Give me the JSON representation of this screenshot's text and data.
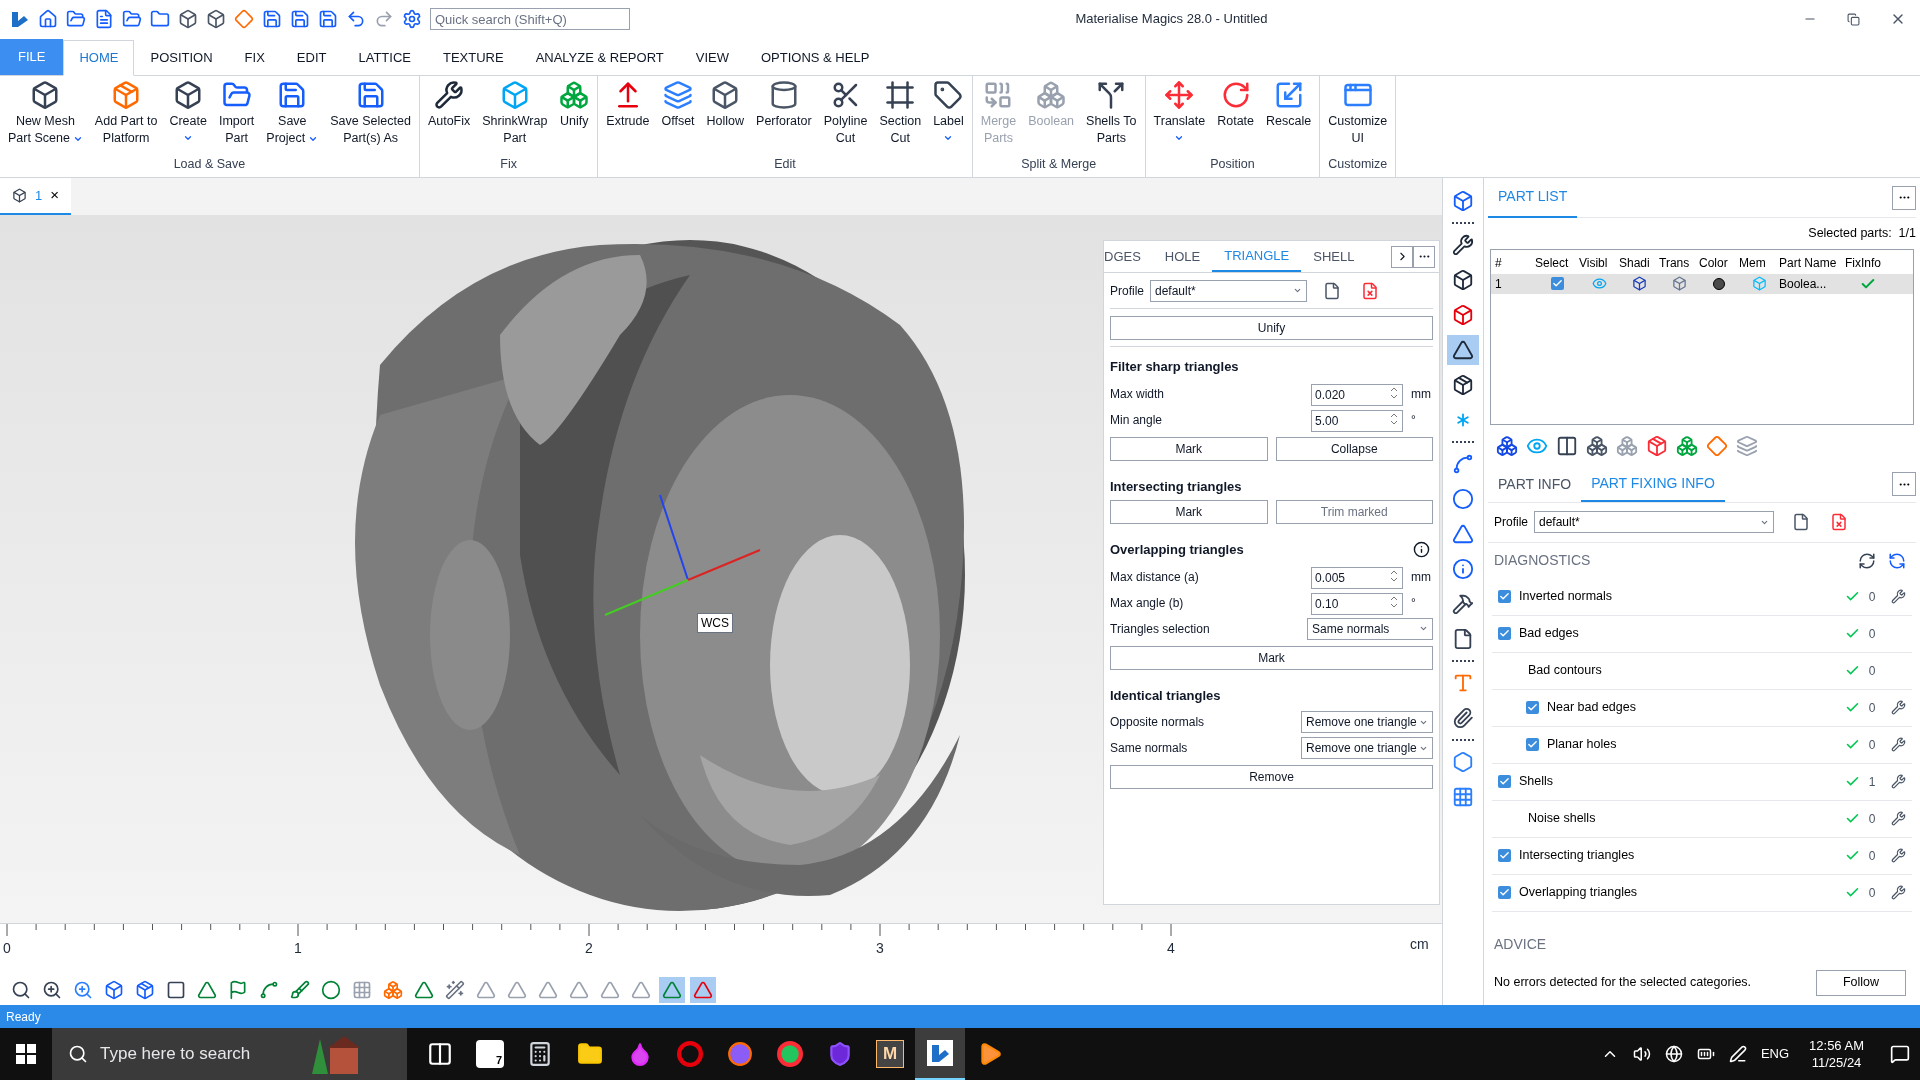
{
  "title_bar": {
    "search": {
      "placeholder": "Quick search (Shift+Q)"
    },
    "title": "Materialise Magics 28.0 - Untitled"
  },
  "menu_tabs": [
    {
      "label": "FILE",
      "kind": "file",
      "selected": false
    },
    {
      "label": "HOME",
      "kind": "tab",
      "selected": true
    },
    {
      "label": "POSITION",
      "kind": "tab",
      "selected": false
    },
    {
      "label": "FIX",
      "kind": "tab",
      "selected": false
    },
    {
      "label": "EDIT",
      "kind": "tab",
      "selected": false
    },
    {
      "label": "LATTICE",
      "kind": "tab",
      "selected": false
    },
    {
      "label": "TEXTURE",
      "kind": "tab",
      "selected": false
    },
    {
      "label": "ANALYZE & REPORT",
      "kind": "tab",
      "selected": false
    },
    {
      "label": "VIEW",
      "kind": "tab",
      "selected": false
    },
    {
      "label": "OPTIONS & HELP",
      "kind": "tab",
      "selected": false
    }
  ],
  "ribbon_groups": [
    {
      "label": "Load & Save",
      "buttons": [
        {
          "lines": [
            "New Mesh",
            "Part Scene"
          ],
          "kind": "mesh",
          "dropdown": true,
          "disabled": false
        },
        {
          "lines": [
            "Add Part to",
            "Platform"
          ],
          "kind": "platform",
          "dropdown": false,
          "disabled": false
        },
        {
          "lines": [
            "Create"
          ],
          "kind": "create",
          "dropdown": true,
          "disabled": false
        },
        {
          "lines": [
            "Import",
            "Part"
          ],
          "kind": "import",
          "dropdown": false,
          "disabled": false
        },
        {
          "lines": [
            "Save",
            "Project"
          ],
          "kind": "save",
          "dropdown": true,
          "disabled": false
        },
        {
          "lines": [
            "Save Selected",
            "Part(s) As"
          ],
          "kind": "save-parts",
          "dropdown": false,
          "disabled": false
        }
      ]
    },
    {
      "label": "Fix",
      "buttons": [
        {
          "lines": [
            "AutoFix"
          ],
          "kind": "autofix",
          "dropdown": false,
          "disabled": false
        },
        {
          "lines": [
            "ShrinkWrap",
            "Part"
          ],
          "kind": "shrinkwrap",
          "dropdown": false,
          "disabled": false
        },
        {
          "lines": [
            "Unify"
          ],
          "kind": "unify",
          "dropdown": false,
          "disabled": false
        }
      ]
    },
    {
      "label": "Edit",
      "buttons": [
        {
          "lines": [
            "Extrude"
          ],
          "kind": "extrude",
          "dropdown": false,
          "disabled": false
        },
        {
          "lines": [
            "Offset"
          ],
          "kind": "offset",
          "dropdown": false,
          "disabled": false
        },
        {
          "lines": [
            "Hollow"
          ],
          "kind": "hollow",
          "dropdown": false,
          "disabled": false
        },
        {
          "lines": [
            "Perforator"
          ],
          "kind": "perforator",
          "dropdown": false,
          "disabled": false
        },
        {
          "lines": [
            "Polyline",
            "Cut"
          ],
          "kind": "polyline",
          "dropdown": false,
          "disabled": false
        },
        {
          "lines": [
            "Section",
            "Cut"
          ],
          "kind": "section",
          "dropdown": false,
          "disabled": false
        },
        {
          "lines": [
            "Label"
          ],
          "kind": "label",
          "dropdown": true,
          "disabled": false
        }
      ]
    },
    {
      "label": "Split & Merge",
      "buttons": [
        {
          "lines": [
            "Merge",
            "Parts"
          ],
          "kind": "merge",
          "dropdown": false,
          "disabled": true
        },
        {
          "lines": [
            "Boolean"
          ],
          "kind": "boolean",
          "dropdown": false,
          "disabled": true
        },
        {
          "lines": [
            "Shells To",
            "Parts"
          ],
          "kind": "shells",
          "dropdown": false,
          "disabled": false
        }
      ]
    },
    {
      "label": "Position",
      "buttons": [
        {
          "lines": [
            "Translate"
          ],
          "kind": "translate",
          "dropdown": true,
          "disabled": false
        },
        {
          "lines": [
            "Rotate"
          ],
          "kind": "rotate",
          "dropdown": false,
          "disabled": false
        },
        {
          "lines": [
            "Rescale"
          ],
          "kind": "rescale",
          "dropdown": false,
          "disabled": false
        }
      ]
    },
    {
      "label": "Customize",
      "buttons": [
        {
          "lines": [
            "Customize",
            "UI"
          ],
          "kind": "customize",
          "dropdown": false,
          "disabled": false
        }
      ]
    }
  ],
  "document_tab": {
    "label": "1",
    "close": "×"
  },
  "viewport": {
    "axis_label": "WCS",
    "ruler": {
      "marks": [
        "0",
        "1",
        "2",
        "3",
        "4"
      ],
      "unit": "cm"
    }
  },
  "fix_panel": {
    "tabs": [
      {
        "label": "DGES",
        "selected": false
      },
      {
        "label": "HOLE",
        "selected": false
      },
      {
        "label": "TRIANGLE",
        "selected": true
      },
      {
        "label": "SHELL",
        "selected": false
      }
    ],
    "profile": {
      "label": "Profile",
      "value": "default*"
    },
    "unify_button": "Unify",
    "sections": [
      {
        "title": "Filter sharp triangles",
        "info": false,
        "fields": [
          {
            "label": "Max width",
            "value": "0.020",
            "unit": "mm"
          },
          {
            "label": "Min angle",
            "value": "5.00",
            "unit": "°"
          }
        ],
        "buttons": [
          {
            "label": "Mark",
            "disabled": false
          },
          {
            "label": "Collapse",
            "disabled": false
          }
        ]
      },
      {
        "title": "Intersecting triangles",
        "info": false,
        "buttons": [
          {
            "label": "Mark",
            "disabled": false
          },
          {
            "label": "Trim marked",
            "disabled": true
          }
        ]
      },
      {
        "title": "Overlapping triangles",
        "info": true,
        "fields": [
          {
            "label": "Max distance (a)",
            "value": "0.005",
            "unit": "mm"
          },
          {
            "label": "Max angle (b)",
            "value": "0.10",
            "unit": "°"
          }
        ],
        "selects": [
          {
            "label": "Triangles selection",
            "value": "Same normals"
          }
        ],
        "buttons": [
          {
            "label": "Mark",
            "disabled": false
          }
        ]
      },
      {
        "title": "Identical triangles",
        "info": false,
        "selects": [
          {
            "label": "Opposite normals",
            "value": "Remove one triangle"
          },
          {
            "label": "Same normals",
            "value": "Remove one triangle"
          }
        ],
        "buttons": [
          {
            "label": "Remove",
            "disabled": false
          }
        ]
      }
    ]
  },
  "side_tools": [
    {
      "kind": "part",
      "selected": false
    },
    {
      "kind": "separator"
    },
    {
      "kind": "wrench",
      "selected": false
    },
    {
      "kind": "box-tool",
      "selected": false
    },
    {
      "kind": "box-red",
      "selected": false
    },
    {
      "kind": "triangle",
      "selected": true
    },
    {
      "kind": "box-dark",
      "selected": false
    },
    {
      "kind": "star",
      "selected": false
    },
    {
      "kind": "separator"
    },
    {
      "kind": "points",
      "selected": false
    },
    {
      "kind": "circle",
      "selected": false
    },
    {
      "kind": "angle",
      "selected": false
    },
    {
      "kind": "distance",
      "selected": false
    },
    {
      "kind": "hammer",
      "selected": false
    },
    {
      "kind": "page",
      "selected": false
    },
    {
      "kind": "separator"
    },
    {
      "kind": "text",
      "selected": false
    },
    {
      "kind": "clip",
      "selected": false
    },
    {
      "kind": "separator"
    },
    {
      "kind": "mesh",
      "selected": false
    },
    {
      "kind": "grid",
      "selected": false
    }
  ],
  "view_tools": [
    {
      "kind": "zoom",
      "selected": false
    },
    {
      "kind": "zoom-fit",
      "selected": false
    },
    {
      "kind": "zoom-select",
      "selected": false
    },
    {
      "kind": "view-cube",
      "selected": false
    },
    {
      "kind": "box",
      "selected": false
    },
    {
      "kind": "shade",
      "selected": false
    },
    {
      "kind": "triangle",
      "selected": false
    },
    {
      "kind": "flag",
      "selected": false
    },
    {
      "kind": "spline",
      "selected": false
    },
    {
      "kind": "brush",
      "selected": false
    },
    {
      "kind": "sphere",
      "selected": false
    },
    {
      "kind": "mesh",
      "selected": false
    },
    {
      "kind": "parts",
      "selected": false
    },
    {
      "kind": "triangle",
      "selected": false
    },
    {
      "kind": "wand",
      "selected": false
    },
    {
      "kind": "triangle-light",
      "selected": false
    },
    {
      "kind": "triangle-light",
      "selected": false
    },
    {
      "kind": "triangle-light",
      "selected": false
    },
    {
      "kind": "triangle-light",
      "selected": false
    },
    {
      "kind": "triangle-light",
      "selected": false
    },
    {
      "kind": "triangle-light",
      "selected": false
    },
    {
      "kind": "triangle",
      "selected": true
    },
    {
      "kind": "triangle-red",
      "selected": true
    }
  ],
  "part_list": {
    "tab": {
      "label": "PART LIST",
      "selected": true
    },
    "summary": "Selected parts:  1/1",
    "columns": [
      "#",
      "Select",
      "Visibl",
      "Shadi",
      "Trans",
      "Color",
      "Mem",
      "Part Name",
      "FixInfo"
    ],
    "rows": [
      {
        "number": "1",
        "selected": true,
        "checked": true,
        "visible": true,
        "color": "#4a4a4a",
        "name": "Boolea...",
        "fixed": true
      }
    ]
  },
  "info_tabs": [
    {
      "label": "PART INFO",
      "selected": false
    },
    {
      "label": "PART FIXING INFO",
      "selected": true
    }
  ],
  "fixing": {
    "profile": {
      "label": "Profile",
      "value": "default*"
    },
    "diagnostics_title": "DIAGNOSTICS",
    "diagnostics": [
      {
        "label": "Inverted normals",
        "kind": "check",
        "checked": true,
        "ok": true,
        "count": "0",
        "fix_tool": true
      },
      {
        "label": "Bad edges",
        "kind": "check",
        "checked": true,
        "ok": true,
        "count": "0",
        "fix_tool": false,
        "children": [
          {
            "label": "Bad contours",
            "kind": "plain",
            "ok": true,
            "count": "0",
            "fix_tool": false,
            "children": [
              {
                "label": "Near bad edges",
                "kind": "check",
                "checked": true,
                "ok": true,
                "count": "0",
                "fix_tool": true
              },
              {
                "label": "Planar holes",
                "kind": "check",
                "checked": true,
                "ok": true,
                "count": "0",
                "fix_tool": true
              }
            ]
          }
        ]
      },
      {
        "label": "Shells",
        "kind": "check",
        "checked": true,
        "ok": true,
        "count": "1",
        "fix_tool": true,
        "children": [
          {
            "label": "Noise shells",
            "kind": "plain",
            "ok": true,
            "count": "0",
            "fix_tool": true
          }
        ]
      },
      {
        "label": "Intersecting triangles",
        "kind": "check",
        "checked": true,
        "ok": true,
        "count": "0",
        "fix_tool": true
      },
      {
        "label": "Overlapping triangles",
        "kind": "check",
        "checked": true,
        "ok": true,
        "count": "0",
        "fix_tool": true
      }
    ],
    "advice_title": "ADVICE",
    "advice": "No errors detected for the selected categories.",
    "follow_button": "Follow"
  },
  "status_bar": "Ready",
  "taskbar": {
    "search": {
      "placeholder": "Type here to search"
    },
    "apps": [
      {
        "kind": "task-view",
        "selected": false
      },
      {
        "kind": "rhino",
        "label": "7",
        "selected": false
      },
      {
        "kind": "calculator",
        "selected": false
      },
      {
        "kind": "explorer",
        "selected": false
      },
      {
        "kind": "drop",
        "selected": false
      },
      {
        "kind": "opera",
        "selected": false
      },
      {
        "kind": "firefox",
        "selected": false
      },
      {
        "kind": "chrome",
        "selected": false
      },
      {
        "kind": "shield",
        "selected": false
      },
      {
        "kind": "letter",
        "label": "M",
        "selected": false
      },
      {
        "kind": "magics",
        "selected": true
      },
      {
        "kind": "player",
        "selected": false
      }
    ],
    "language": "ENG",
    "time": "12:56 AM",
    "date": "11/25/24"
  }
}
